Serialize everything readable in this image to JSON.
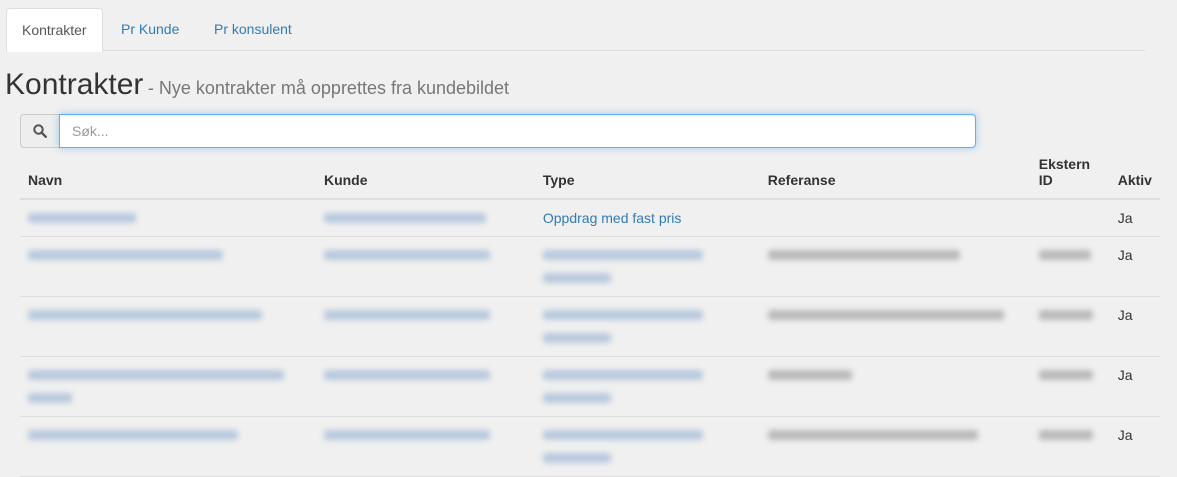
{
  "tabs": [
    {
      "label": "Kontrakter",
      "active": true
    },
    {
      "label": "Pr Kunde",
      "active": false
    },
    {
      "label": "Pr konsulent",
      "active": false
    }
  ],
  "page": {
    "title": "Kontrakter",
    "subtitle": "- Nye kontrakter må opprettes fra kundebildet"
  },
  "search": {
    "placeholder": "Søk...",
    "value": "",
    "icon": "search-icon"
  },
  "table": {
    "columns": [
      "Navn",
      "Kunde",
      "Type",
      "Referanse",
      "Ekstern ID",
      "Aktiv"
    ],
    "rows": [
      {
        "type": "Oppdrag med fast pris",
        "aktiv": "Ja"
      },
      {
        "aktiv": "Ja"
      },
      {
        "aktiv": "Ja"
      },
      {
        "aktiv": "Ja"
      },
      {
        "aktiv": "Ja"
      }
    ]
  },
  "colors": {
    "link": "#337ab7",
    "border": "#dddddd",
    "background": "#f0f0f0"
  }
}
